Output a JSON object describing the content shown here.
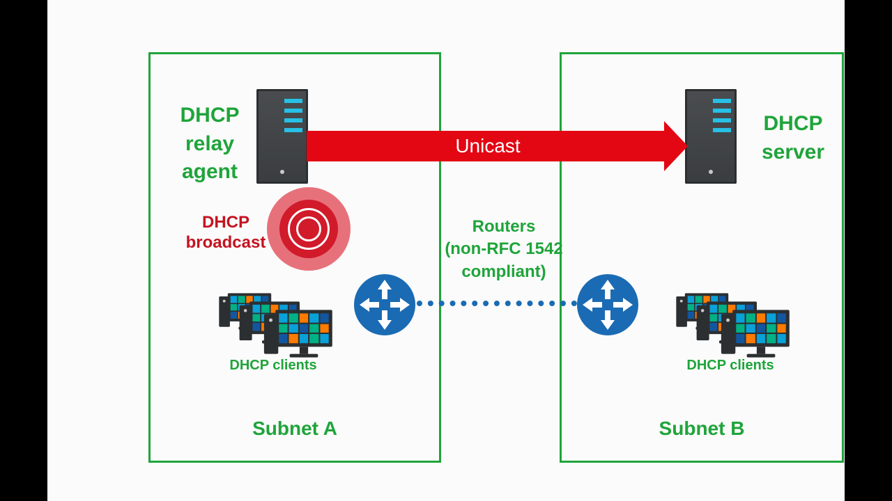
{
  "subnets": {
    "a": {
      "title": "Subnet A",
      "clients_label": "DHCP clients"
    },
    "b": {
      "title": "Subnet B",
      "clients_label": "DHCP clients"
    }
  },
  "servers": {
    "relay_agent_label": "DHCP\nrelay\nagent",
    "dhcp_server_label": "DHCP\nserver"
  },
  "broadcast": {
    "label": "DHCP\nbroadcast"
  },
  "unicast": {
    "label": "Unicast"
  },
  "routers": {
    "label": "Routers\n(non-RFC 1542\ncompliant)"
  },
  "colors": {
    "green": "#1fa43a",
    "red": "#e30613",
    "blue": "#1a6bb3"
  }
}
